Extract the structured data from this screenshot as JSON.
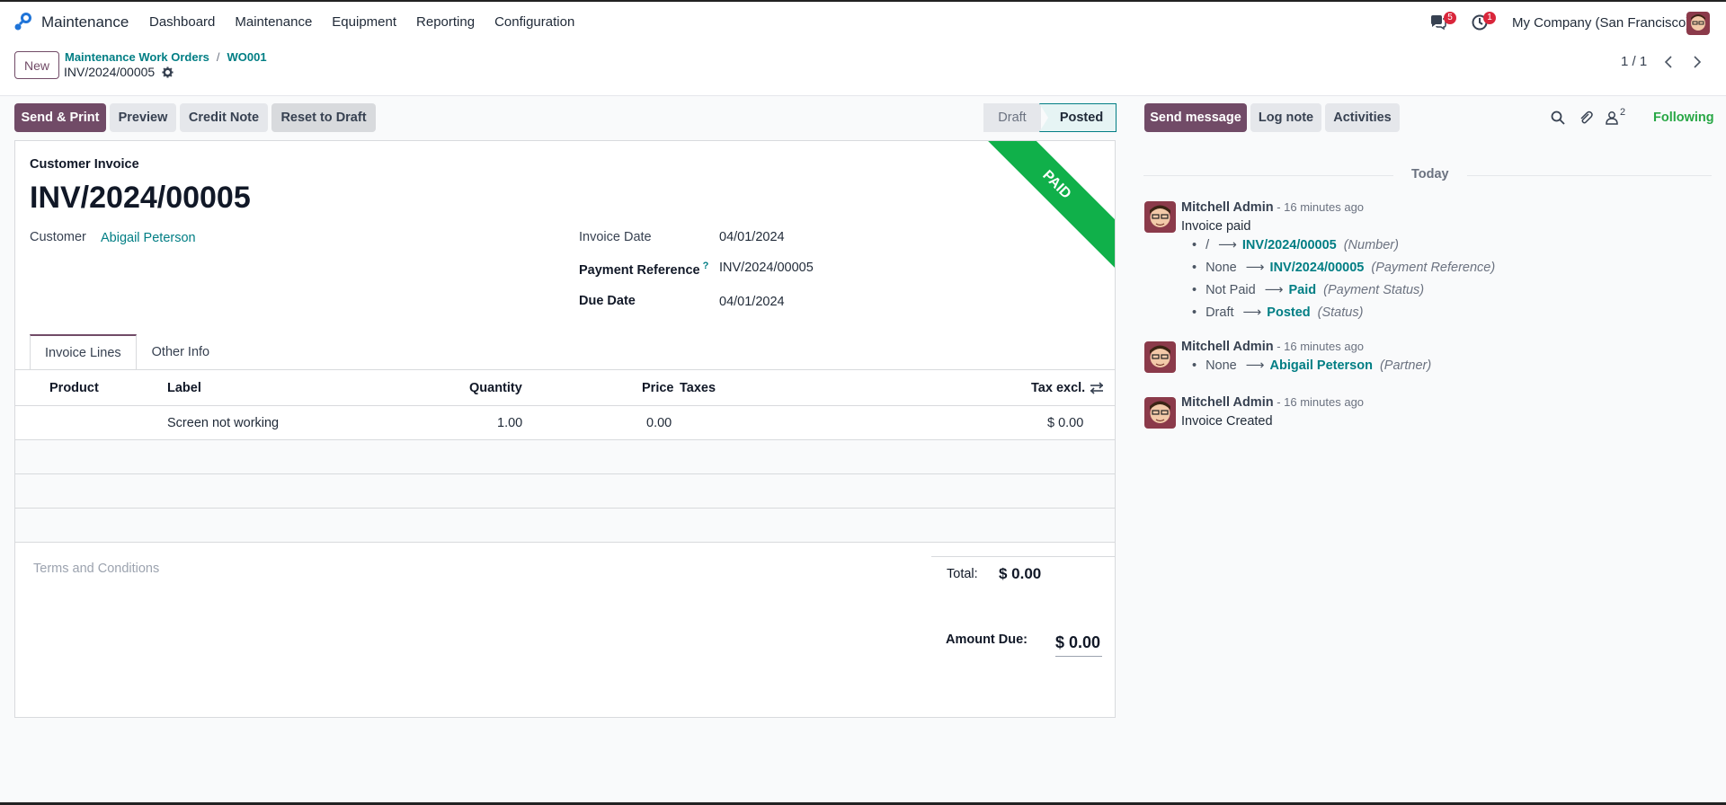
{
  "navbar": {
    "app_name": "Maintenance",
    "menu": [
      "Dashboard",
      "Maintenance",
      "Equipment",
      "Reporting",
      "Configuration"
    ],
    "messages_badge": "5",
    "activities_badge": "1",
    "company": "My Company (San Francisco)"
  },
  "control_panel": {
    "new_label": "New",
    "breadcrumb": [
      "Maintenance Work Orders",
      "WO001"
    ],
    "breadcrumb_sep": "/",
    "record_name": "INV/2024/00005",
    "pager": "1 / 1"
  },
  "actions": {
    "send_print": "Send & Print",
    "preview": "Preview",
    "credit_note": "Credit Note",
    "reset_draft": "Reset to Draft"
  },
  "status": {
    "draft": "Draft",
    "posted": "Posted",
    "current": "Posted"
  },
  "invoice": {
    "ribbon": "PAID",
    "type": "Customer Invoice",
    "number": "INV/2024/00005",
    "customer_label": "Customer",
    "customer": "Abigail Peterson",
    "invoice_date_label": "Invoice Date",
    "invoice_date": "04/01/2024",
    "payment_ref_label": "Payment Reference",
    "payment_ref_help": "?",
    "payment_ref": "INV/2024/00005",
    "due_date_label": "Due Date",
    "due_date": "04/01/2024",
    "tabs": [
      "Invoice Lines",
      "Other Info"
    ],
    "columns": {
      "product": "Product",
      "label": "Label",
      "quantity": "Quantity",
      "price": "Price",
      "taxes": "Taxes",
      "tax_excl": "Tax excl."
    },
    "lines": [
      {
        "product": "",
        "label": "Screen not working",
        "quantity": "1.00",
        "price": "0.00",
        "taxes": "",
        "subtotal": "$ 0.00"
      }
    ],
    "terms_placeholder": "Terms and Conditions",
    "total_label": "Total:",
    "total": "$ 0.00",
    "amount_due_label": "Amount Due:",
    "amount_due": "$ 0.00"
  },
  "chatter": {
    "send_message": "Send message",
    "log_note": "Log note",
    "activities": "Activities",
    "followers_count": "2",
    "following": "Following",
    "today": "Today",
    "messages": [
      {
        "author": "Mitchell Admin",
        "time": " - 16 minutes ago",
        "body": "Invoice paid",
        "tracking": [
          {
            "old": "/",
            "new": "INV/2024/00005",
            "field": "(Number)"
          },
          {
            "old": "None",
            "new": "INV/2024/00005",
            "field": "(Payment Reference)"
          },
          {
            "old": "Not Paid",
            "new": "Paid",
            "field": "(Payment Status)"
          },
          {
            "old": "Draft",
            "new": "Posted",
            "field": "(Status)"
          }
        ]
      },
      {
        "author": "Mitchell Admin",
        "time": " - 16 minutes ago",
        "body": "",
        "tracking": [
          {
            "old": "None",
            "new": "Abigail Peterson",
            "field": "(Partner)"
          }
        ]
      },
      {
        "author": "Mitchell Admin",
        "time": " - 16 minutes ago",
        "body": "Invoice Created",
        "tracking": []
      }
    ]
  },
  "colors": {
    "brand": "#714b67",
    "link": "#017e84",
    "paid_ribbon": "#10b04a",
    "following": "#28a745",
    "badge": "#d9263b"
  }
}
